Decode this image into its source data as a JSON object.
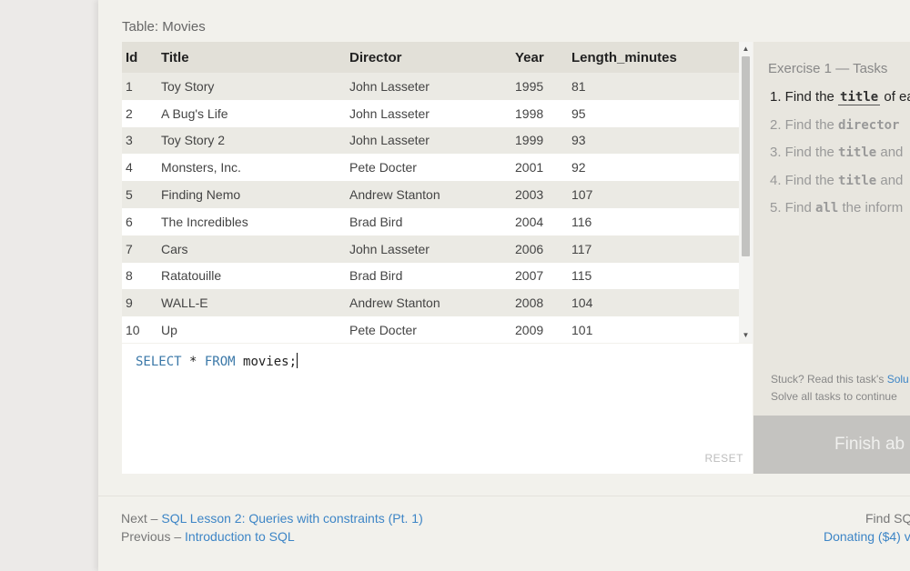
{
  "table_caption": "Table: Movies",
  "results_table": {
    "columns": [
      "Id",
      "Title",
      "Director",
      "Year",
      "Length_minutes"
    ],
    "rows": [
      [
        "1",
        "Toy Story",
        "John Lasseter",
        "1995",
        "81"
      ],
      [
        "2",
        "A Bug's Life",
        "John Lasseter",
        "1998",
        "95"
      ],
      [
        "3",
        "Toy Story 2",
        "John Lasseter",
        "1999",
        "93"
      ],
      [
        "4",
        "Monsters, Inc.",
        "Pete Docter",
        "2001",
        "92"
      ],
      [
        "5",
        "Finding Nemo",
        "Andrew Stanton",
        "2003",
        "107"
      ],
      [
        "6",
        "The Incredibles",
        "Brad Bird",
        "2004",
        "116"
      ],
      [
        "7",
        "Cars",
        "John Lasseter",
        "2006",
        "117"
      ],
      [
        "8",
        "Ratatouille",
        "Brad Bird",
        "2007",
        "115"
      ],
      [
        "9",
        "WALL-E",
        "Andrew Stanton",
        "2008",
        "104"
      ],
      [
        "10",
        "Up",
        "Pete Docter",
        "2009",
        "101"
      ]
    ]
  },
  "editor": {
    "keyword1": "SELECT",
    "star": " * ",
    "keyword2": "FROM",
    "rest": " movies;",
    "reset_label": "RESET"
  },
  "tasks": {
    "title": "Exercise 1 — Tasks",
    "items": [
      {
        "prefix": "1. Find the ",
        "code": "title",
        "suffix": " of ea"
      },
      {
        "prefix": "2. Find the ",
        "code": "director",
        "suffix": ""
      },
      {
        "prefix": "3. Find the ",
        "code": "title",
        "suffix": " and"
      },
      {
        "prefix": "4. Find the ",
        "code": "title",
        "suffix": " and"
      },
      {
        "prefix": "5. Find ",
        "code": "all",
        "suffix": " the inform"
      }
    ],
    "stuck_text": "Stuck? Read this task's ",
    "stuck_link": "Solu",
    "solve_text": "Solve all tasks to continue",
    "finish_label": "Finish ab"
  },
  "footer": {
    "next_prefix": "Next – ",
    "next_link": "SQL Lesson 2: Queries with constraints (Pt. 1)",
    "prev_prefix": "Previous – ",
    "prev_link": "Introduction to SQL",
    "right_top": "Find SQ",
    "right_link": "Donating ($4) v"
  },
  "colors": {
    "link": "#3d85c6",
    "sql_keyword": "#3b78a8"
  },
  "icons": [
    "scroll-up-arrow-icon",
    "scroll-down-arrow-icon"
  ]
}
